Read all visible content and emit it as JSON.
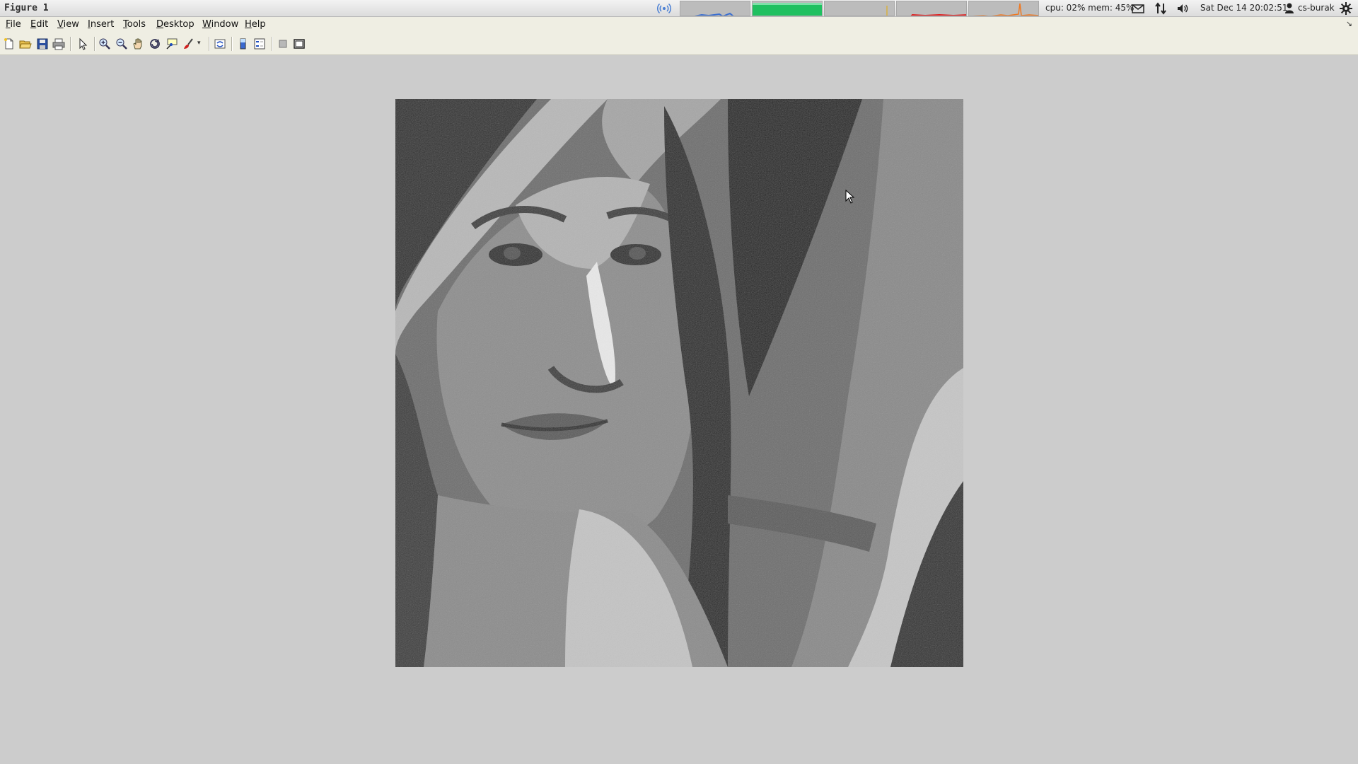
{
  "window": {
    "title": "Figure 1"
  },
  "top_panel": {
    "status": "cpu: 02% mem: 45%",
    "datetime": "Sat Dec 14 20:02:51",
    "user": "cs-burak",
    "icons": [
      "network-wireless-icon",
      "mail-icon",
      "network-transfer-icon",
      "volume-icon",
      "user-icon",
      "settings-gear-icon"
    ],
    "graph_colors": [
      "#3b6fd0",
      "#20c060",
      "#d8b040",
      "#e02020",
      "#f07820"
    ]
  },
  "menubar": {
    "items": [
      {
        "mnemonic": "F",
        "rest": "ile"
      },
      {
        "mnemonic": "E",
        "rest": "dit"
      },
      {
        "mnemonic": "V",
        "rest": "iew"
      },
      {
        "mnemonic": "I",
        "rest": "nsert"
      },
      {
        "mnemonic": "T",
        "rest": "ools"
      },
      {
        "mnemonic": "D",
        "rest": "esktop"
      },
      {
        "mnemonic": "W",
        "rest": "indow"
      },
      {
        "mnemonic": "H",
        "rest": "elp"
      }
    ],
    "dock_glyph": "↘"
  },
  "toolbar": {
    "buttons": [
      "new-figure-icon",
      "open-file-icon",
      "save-icon",
      "print-icon",
      "edit-plot-arrow-icon",
      "zoom-in-icon",
      "zoom-out-icon",
      "pan-hand-icon",
      "rotate-3d-icon",
      "data-cursor-icon",
      "brush-icon",
      "link-plot-icon",
      "colorbar-icon",
      "legend-icon",
      "hide-plot-tools-icon",
      "show-plot-tools-icon"
    ]
  },
  "figure": {
    "image": "grayscale-posterized-portrait",
    "colors": {
      "background": "#cccccc",
      "image_dark": "#2a2a2a",
      "image_mid": "#707070",
      "image_light": "#c8c8c8"
    }
  }
}
